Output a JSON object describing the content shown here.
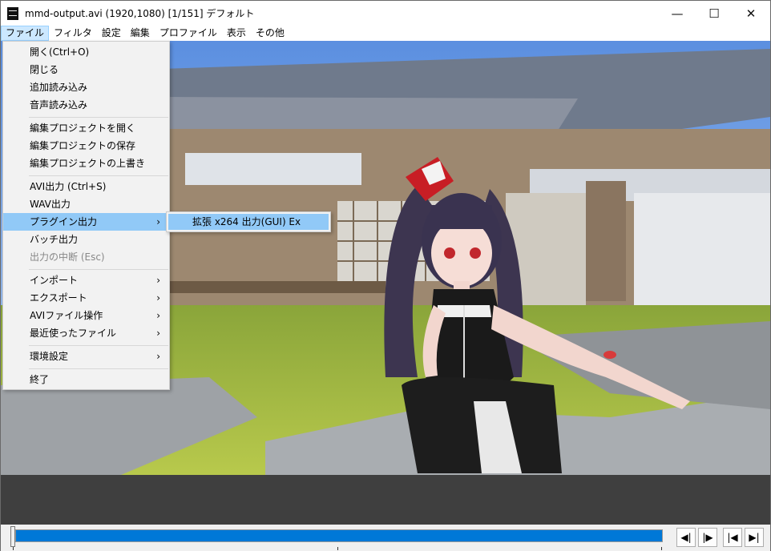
{
  "window": {
    "title": "mmd-output.avi (1920,1080)  [1/151]  デフォルト",
    "minimize": "—",
    "maximize": "☐",
    "close": "✕"
  },
  "menubar": [
    "ファイル",
    "フィルタ",
    "設定",
    "編集",
    "プロファイル",
    "表示",
    "その他"
  ],
  "file_menu": {
    "items": [
      {
        "label": "開く(Ctrl+O)"
      },
      {
        "label": "閉じる"
      },
      {
        "label": "追加読み込み"
      },
      {
        "label": "音声読み込み"
      },
      {
        "label": "編集プロジェクトを開く"
      },
      {
        "label": "編集プロジェクトの保存"
      },
      {
        "label": "編集プロジェクトの上書き"
      },
      {
        "label": "AVI出力 (Ctrl+S)"
      },
      {
        "label": "WAV出力"
      },
      {
        "label": "プラグイン出力",
        "submenu": true,
        "highlighted": true
      },
      {
        "label": "バッチ出力"
      },
      {
        "label": "出力の中断 (Esc)",
        "disabled": true
      },
      {
        "label": "インポート",
        "submenu": true
      },
      {
        "label": "エクスポート",
        "submenu": true
      },
      {
        "label": "AVIファイル操作",
        "submenu": true
      },
      {
        "label": "最近使ったファイル",
        "submenu": true
      },
      {
        "label": "環境設定",
        "submenu": true
      },
      {
        "label": "終了"
      }
    ],
    "submenu_arrow": "›"
  },
  "plugin_submenu": {
    "items": [
      {
        "label": "拡張 x264 出力(GUI) Ex"
      }
    ]
  },
  "timeline": {
    "position": 0.0,
    "buttons": [
      "◀|",
      "|▶",
      "|◀",
      "▶|"
    ]
  },
  "colors": {
    "accent": "#0078d7",
    "menu_highlight": "#91c9f7",
    "panel_bg": "#f2f2f2"
  }
}
